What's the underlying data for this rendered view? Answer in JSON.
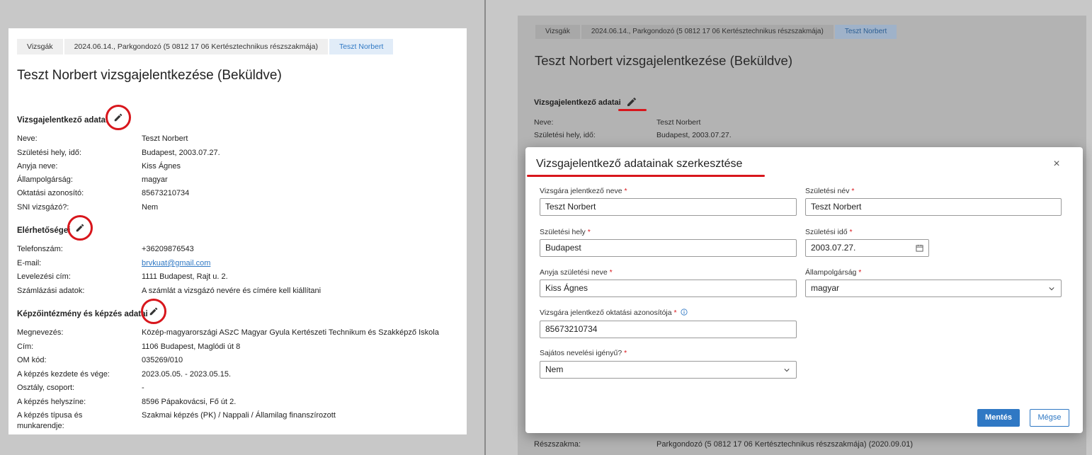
{
  "left": {
    "breadcrumbs": [
      "Vizsgák",
      "2024.06.14., Parkgondozó (5 0812 17 06 Kertésztechnikus részszakmája)",
      "Teszt Norbert"
    ],
    "title": "Teszt Norbert vizsgajelentkezése (Beküldve)",
    "section1": {
      "title": "Vizsgajelentkező adatai",
      "rows": [
        {
          "k": "Neve:",
          "v": "Teszt Norbert"
        },
        {
          "k": "Születési hely, idő:",
          "v": "Budapest, 2003.07.27."
        },
        {
          "k": "Anyja neve:",
          "v": "Kiss Ágnes"
        },
        {
          "k": "Állampolgárság:",
          "v": "magyar"
        },
        {
          "k": "Oktatási azonosító:",
          "v": "85673210734"
        },
        {
          "k": "SNI vizsgázó?:",
          "v": "Nem"
        }
      ]
    },
    "section2": {
      "title": "Elérhetőségei",
      "rows": [
        {
          "k": "Telefonszám:",
          "v": "+36209876543"
        },
        {
          "k": "E-mail:",
          "v": "brvkuat@gmail.com"
        },
        {
          "k": "Levelezési cím:",
          "v": "1111 Budapest, Rajt u. 2."
        },
        {
          "k": "Számlázási adatok:",
          "v": "A számlát a vizsgázó nevére és címére kell kiállítani"
        }
      ]
    },
    "section3": {
      "title": "Képzőintézmény és képzés adatai",
      "rows": [
        {
          "k": "Megnevezés:",
          "v": "Közép-magyarországi ASzC Magyar Gyula Kertészeti Technikum és Szakképző Iskola"
        },
        {
          "k": "Cím:",
          "v": "1106 Budapest, Maglódi út 8"
        },
        {
          "k": "OM kód:",
          "v": "035269/010"
        },
        {
          "k": "A képzés kezdete és vége:",
          "v": "2023.05.05. - 2023.05.15."
        },
        {
          "k": "Osztály, csoport:",
          "v": "-"
        },
        {
          "k": "A képzés helyszíne:",
          "v": "8596 Pápakovácsi, Fő út 2."
        },
        {
          "k": "A képzés típusa és",
          "v": "Szakmai képzés (PK) / Nappali / Államilag finanszírozott"
        },
        {
          "k": "munkarendje:",
          "v": ""
        }
      ]
    }
  },
  "right": {
    "breadcrumbs": [
      "Vizsgák",
      "2024.06.14., Parkgondozó (5 0812 17 06 Kertésztechnikus részszakmája)",
      "Teszt Norbert"
    ],
    "title": "Teszt Norbert vizsgajelentkezése (Beküldve)",
    "section_title": "Vizsgajelentkező adatai",
    "rows": [
      {
        "k": "Neve:",
        "v": "Teszt Norbert"
      },
      {
        "k": "Születési hely, idő:",
        "v": "Budapest, 2003.07.27."
      }
    ],
    "bottom_row": {
      "k": "Részszakma:",
      "v": "Parkgondozó (5 0812 17 06 Kertésztechnikus részszakmája) (2020.09.01)"
    },
    "modal": {
      "title": "Vizsgajelentkező adatainak szerkesztése",
      "close": "×",
      "fields": {
        "name_label": "Vizsgára jelentkező neve",
        "name_value": "Teszt Norbert",
        "birthname_label": "Születési név",
        "birthname_value": "Teszt Norbert",
        "birthplace_label": "Születési hely",
        "birthplace_value": "Budapest",
        "birthdate_label": "Születési idő",
        "birthdate_value": "2003.07.27.",
        "mother_label": "Anyja születési neve",
        "mother_value": "Kiss Ágnes",
        "citizenship_label": "Állampolgárság",
        "citizenship_value": "magyar",
        "eduid_label": "Vizsgára jelentkező oktatási azonosítója",
        "eduid_value": "85673210734",
        "sni_label": "Sajátos nevelési igényű?",
        "sni_value": "Nem"
      },
      "required_mark": "*",
      "save_label": "Mentés",
      "cancel_label": "Mégse"
    }
  },
  "colors": {
    "accent": "#2f78c4",
    "highlight_red": "#d8161c"
  }
}
